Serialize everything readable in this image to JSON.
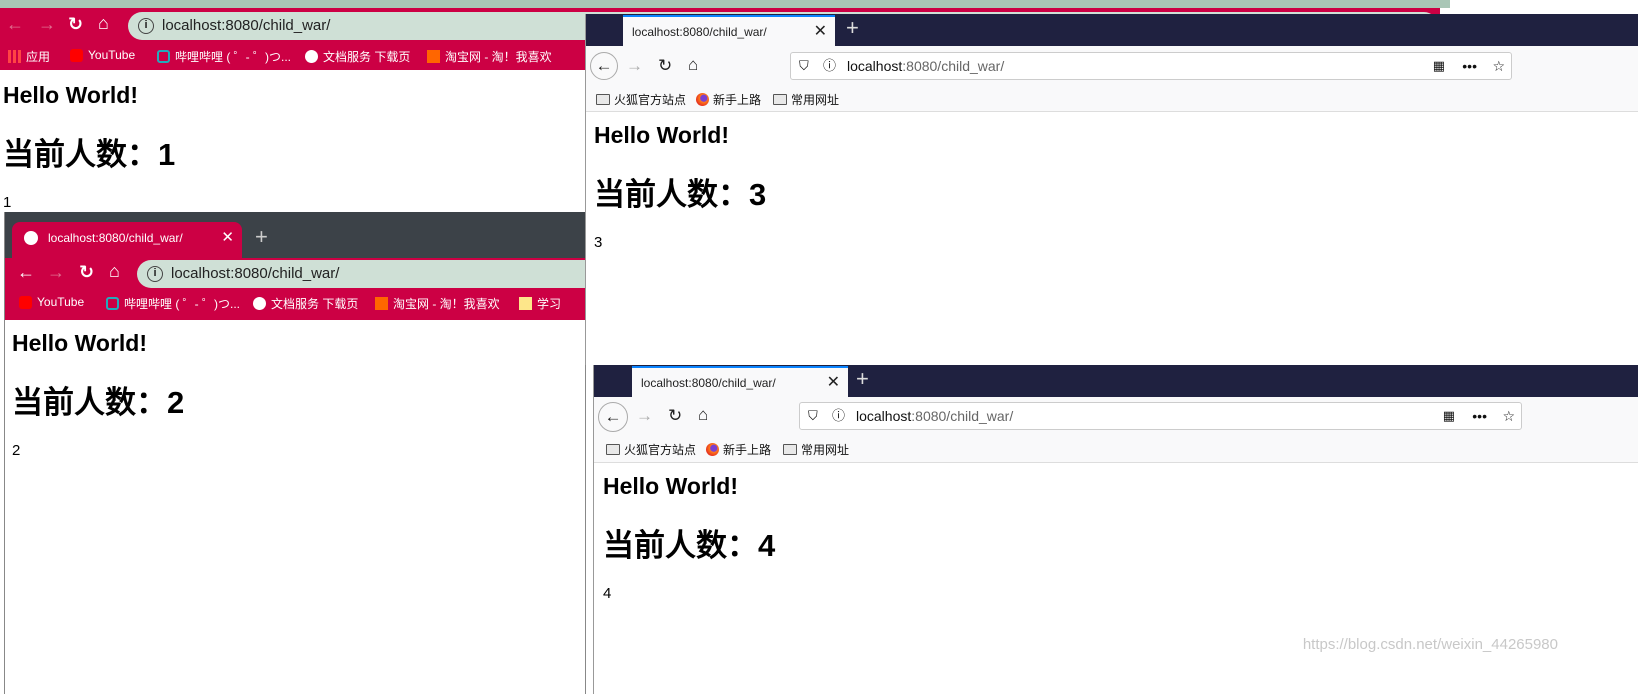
{
  "url": {
    "host": "localhost",
    "rest": ":8080/child_war/",
    "full": "localhost:8080/child_war/"
  },
  "chrome_bookmarks": [
    "应用",
    "YouTube",
    "哔哩哔哩 ( ゜- ゜)つ...",
    "文档服务 下载页",
    "淘宝网 - 淘！我喜欢",
    "学习"
  ],
  "firefox_bookmarks": [
    "火狐官方站点",
    "新手上路",
    "常用网址"
  ],
  "tab_title": "localhost:8080/child_war/",
  "windows": [
    {
      "heading": "Hello World!",
      "count_heading": "当前人数：1",
      "count": "1"
    },
    {
      "heading": "Hello World!",
      "count_heading": "当前人数：2",
      "count": "2"
    },
    {
      "heading": "Hello World!",
      "count_heading": "当前人数：3",
      "count": "3"
    },
    {
      "heading": "Hello World!",
      "count_heading": "当前人数：4",
      "count": "4"
    }
  ],
  "watermark": "https://blog.csdn.net/weixin_44265980",
  "colors": {
    "chrome_theme": "#cc0044",
    "firefox_tabbar": "#1f2140",
    "omnibox": "#cfe0d6"
  }
}
